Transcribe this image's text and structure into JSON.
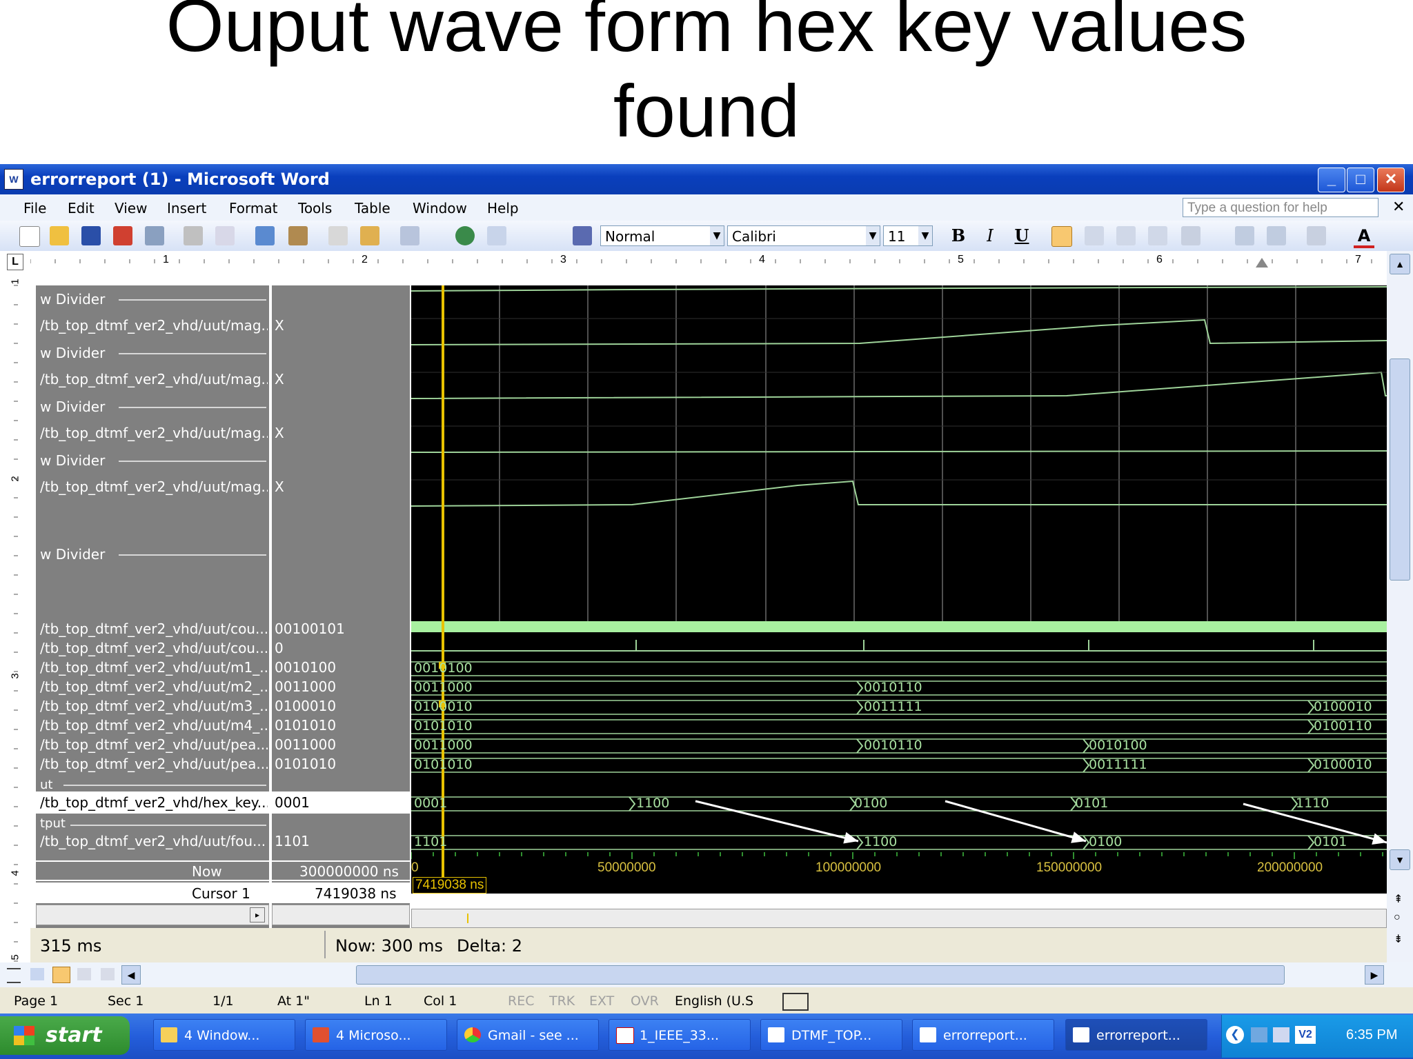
{
  "slide": {
    "title_line1": "Ouput wave form hex key values",
    "title_line2": "found"
  },
  "window": {
    "title": "errorreport (1) - Microsoft Word",
    "min": "_",
    "max": "□",
    "close": "✕"
  },
  "menu": {
    "items": [
      "File",
      "Edit",
      "View",
      "Insert",
      "Format",
      "Tools",
      "Table",
      "Window",
      "Help"
    ],
    "help_placeholder": "Type a question for help",
    "close_doc": "✕"
  },
  "toolbar": {
    "style": "Normal",
    "font": "Calibri",
    "size": "11",
    "bold": "B",
    "italic": "I",
    "underline": "U",
    "font_color": "A"
  },
  "ruler": {
    "numbers": [
      "1",
      "2",
      "3",
      "4",
      "5",
      "6",
      "7"
    ]
  },
  "vruler": {
    "numbers": [
      "1",
      "2",
      "3",
      "4",
      "5"
    ]
  },
  "waveform": {
    "names": [
      "w Divider",
      "/tb_top_dtmf_ver2_vhd/uut/mag...",
      "w Divider",
      "/tb_top_dtmf_ver2_vhd/uut/mag...",
      "w Divider",
      "/tb_top_dtmf_ver2_vhd/uut/mag...",
      "w Divider",
      "/tb_top_dtmf_ver2_vhd/uut/mag...",
      "w Divider",
      "/tb_top_dtmf_ver2_vhd/uut/cou...",
      "/tb_top_dtmf_ver2_vhd/uut/cou...",
      "/tb_top_dtmf_ver2_vhd/uut/m1_...",
      "/tb_top_dtmf_ver2_vhd/uut/m2_...",
      "/tb_top_dtmf_ver2_vhd/uut/m3_...",
      "/tb_top_dtmf_ver2_vhd/uut/m4_...",
      "/tb_top_dtmf_ver2_vhd/uut/pea...",
      "/tb_top_dtmf_ver2_vhd/uut/pea...",
      "ut",
      "/tb_top_dtmf_ver2_vhd/hex_key...",
      "tput",
      "/tb_top_dtmf_ver2_vhd/uut/fou..."
    ],
    "values": [
      "X",
      "X",
      "X",
      "X",
      "00100101",
      "0",
      "0010100",
      "0011000",
      "0100010",
      "0101010",
      "0011000",
      "0101010",
      "0001",
      "1101"
    ],
    "now_label": "Now",
    "now_value": "300000000 ns",
    "cursor_label": "Cursor 1",
    "cursor_value": "7419038 ns",
    "cursor_tag": "7419038 ns",
    "bus_labels": {
      "m1": [
        "0010100"
      ],
      "m2": [
        "0011000",
        "0010110"
      ],
      "m3": [
        "0100010",
        "0011111",
        "0100010"
      ],
      "m4": [
        "0101010",
        "0100110"
      ],
      "pea1": [
        "0011000",
        "0010110",
        "0010100"
      ],
      "pea2": [
        "0101010",
        "0011111",
        "0100010"
      ],
      "hex": [
        "0001",
        "1100",
        "0100",
        "0101",
        "1110"
      ],
      "fou": [
        "1101",
        "1100",
        "0100",
        "0101"
      ]
    },
    "time_ticks": [
      "0",
      "50000000",
      "100000000",
      "150000000",
      "200000000"
    ],
    "status_left": "315 ms",
    "status_now": "Now: 300 ms",
    "status_delta": "Delta: 2"
  },
  "statusbar": {
    "page": "Page  1",
    "sec": "Sec  1",
    "pages": "1/1",
    "at": "At  1\"",
    "ln": "Ln  1",
    "col": "Col  1",
    "rec": "REC",
    "trk": "TRK",
    "ext": "EXT",
    "ovr": "OVR",
    "lang": "English (U.S"
  },
  "taskbar": {
    "start": "start",
    "tasks": [
      "4 Window...",
      "4 Microso...",
      "Gmail - see ...",
      "1_IEEE_33...",
      "DTMF_TOP...",
      "errorreport...",
      "errorreport..."
    ],
    "clock": "6:35 PM",
    "tray_text": "V2"
  },
  "colors": {
    "wave_green": "#9fd49a",
    "grid": "#6a6a6a",
    "cursor": "#e8c200",
    "bar": "#a8f0a0",
    "pane_gray": "#808080"
  }
}
